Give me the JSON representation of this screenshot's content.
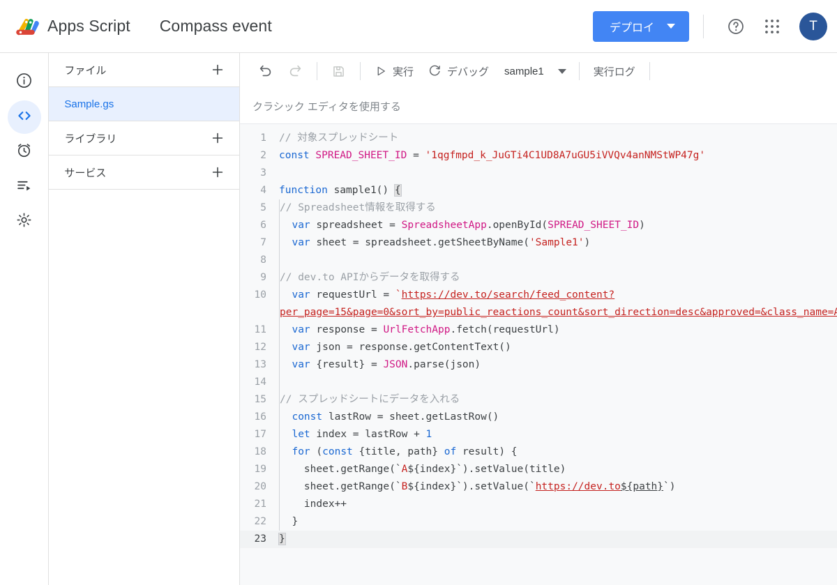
{
  "header": {
    "app_title": "Apps Script",
    "doc_title": "Compass event",
    "deploy_label": "デプロイ",
    "help_icon": "help-circle-icon",
    "apps_icon": "apps-grid-icon",
    "avatar_initial": "T",
    "accent_color": "#4285f4",
    "avatar_color": "#2a5699"
  },
  "rail": {
    "items": [
      {
        "name": "overview",
        "icon": "info-circle-icon",
        "active": false
      },
      {
        "name": "editor",
        "icon": "code-brackets-icon",
        "active": true
      },
      {
        "name": "triggers",
        "icon": "alarm-clock-icon",
        "active": false
      },
      {
        "name": "executions",
        "icon": "executions-play-icon",
        "active": false
      },
      {
        "name": "settings",
        "icon": "gear-icon",
        "active": false
      }
    ]
  },
  "panel": {
    "files_label": "ファイル",
    "add_file_icon": "plus-icon",
    "file_items": [
      {
        "label": "Sample.gs",
        "selected": true
      }
    ],
    "libraries_label": "ライブラリ",
    "add_library_icon": "plus-icon",
    "services_label": "サービス",
    "add_service_icon": "plus-icon"
  },
  "toolbar": {
    "undo_icon": "undo-arrow-icon",
    "redo_icon": "redo-arrow-icon",
    "save_icon": "save-disk-icon",
    "run_label": "実行",
    "run_icon": "play-triangle-icon",
    "debug_label": "デバッグ",
    "debug_icon": "debug-icon",
    "function_name": "sample1",
    "function_caret_icon": "chevron-down-icon",
    "execution_log_label": "実行ログ"
  },
  "classic_bar": {
    "link_label": "クラシック エディタを使用する"
  },
  "code": {
    "language": "javascript",
    "lines": [
      {
        "n": 1
      },
      {
        "n": 2
      },
      {
        "n": 3
      },
      {
        "n": 4
      },
      {
        "n": 5
      },
      {
        "n": 6
      },
      {
        "n": 7
      },
      {
        "n": 8
      },
      {
        "n": 9
      },
      {
        "n": 10
      },
      {
        "n": 11
      },
      {
        "n": 12
      },
      {
        "n": 13
      },
      {
        "n": 14
      },
      {
        "n": 15
      },
      {
        "n": 16
      },
      {
        "n": 17
      },
      {
        "n": 18
      },
      {
        "n": 19
      },
      {
        "n": 20
      },
      {
        "n": 21
      },
      {
        "n": 22
      },
      {
        "n": 23
      }
    ],
    "line_numbers": {
      "l1": "1",
      "l2": "2",
      "l3": "3",
      "l4": "4",
      "l5": "5",
      "l6": "6",
      "l7": "7",
      "l8": "8",
      "l9": "9",
      "l10": "10",
      "l11": "11",
      "l12": "12",
      "l13": "13",
      "l14": "14",
      "l15": "15",
      "l16": "16",
      "l17": "17",
      "l18": "18",
      "l19": "19",
      "l20": "20",
      "l21": "21",
      "l22": "22",
      "l23": "23"
    },
    "text": {
      "c1_comment": "// 対象スプレッドシート",
      "c2_kw": "const",
      "c2_name": " SPREAD_SHEET_ID ",
      "c2_eq": "= ",
      "c2_str": "'1qgfmpd_k_JuGTi4C1UD8A7uGU5iVVQv4anNMStWP47g'",
      "c4_kw": "function",
      "c4_name": " sample1() ",
      "c4_brace": "{",
      "c5_comment": "// Spreadsheet情報を取得する",
      "c6_kw": "var",
      "c6_mid": " spreadsheet = ",
      "c6_cls": "SpreadsheetApp",
      "c6_call": ".openById(",
      "c6_arg": "SPREAD_SHEET_ID",
      "c6_end": ")",
      "c7_kw": "var",
      "c7_mid": " sheet = spreadsheet.getSheetByName(",
      "c7_str": "'Sample1'",
      "c7_end": ")",
      "c9_comment": "// dev.to APIからデータを取得する",
      "c10_kw": "var",
      "c10_mid": " requestUrl = ",
      "c10_tick_open": "`",
      "c10_url": "https://dev.to/search/feed_content?per_page=15&page=0&sort_by=public_reactions_count&sort_direction=desc&approved=&class_name=Article",
      "c10_tick_close": "`",
      "c11_kw": "var",
      "c11_mid": " response = ",
      "c11_cls": "UrlFetchApp",
      "c11_end": ".fetch(requestUrl)",
      "c12_kw": "var",
      "c12_rest": " json = response.getContentText()",
      "c13_kw": "var",
      "c13_mid": " {result} = ",
      "c13_cls": "JSON",
      "c13_end": ".parse(json)",
      "c15_comment": "// スプレッドシートにデータを入れる",
      "c16_kw": "const",
      "c16_rest": " lastRow = sheet.getLastRow()",
      "c17_kw": "let",
      "c17_mid": " index = lastRow + ",
      "c17_num": "1",
      "c18_kw": "for",
      "c18_p1": " (",
      "c18_kw2": "const",
      "c18_p2": " {title, path} ",
      "c18_kw3": "of",
      "c18_p3": " result) {",
      "c19_pre": "sheet.getRange(`",
      "c19_str": "A",
      "c19_tpl": "${index}",
      "c19_post": "`).setValue(title)",
      "c20_pre": "sheet.getRange(`",
      "c20_str": "B",
      "c20_tpl": "${index}",
      "c20_mid": "`).setValue(`",
      "c20_url": "https://dev.to",
      "c20_tpl2": "${path}",
      "c20_post": "`)",
      "c21": "index++",
      "c22": "}",
      "c23": "}"
    }
  }
}
